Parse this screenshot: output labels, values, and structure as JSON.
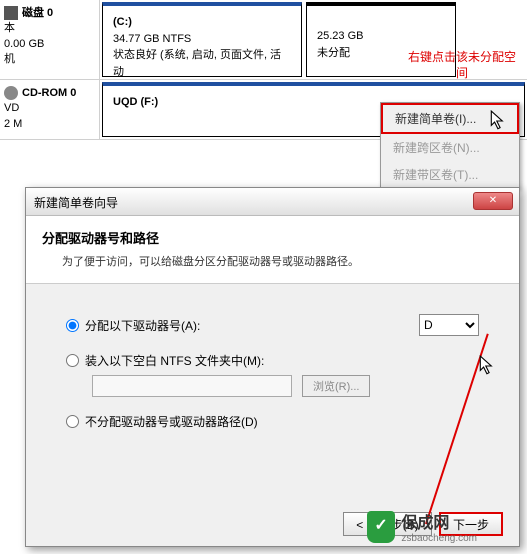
{
  "disk_mgmt": {
    "disk0": {
      "name": "磁盘 0",
      "type": "本",
      "size": "0.00 GB",
      "status": "机"
    },
    "partition_c": {
      "label": "(C:)",
      "size": "34.77 GB NTFS",
      "status": "状态良好 (系统, 启动, 页面文件, 活动"
    },
    "partition_unalloc": {
      "size": "25.23 GB",
      "status": "未分配"
    },
    "cdrom": {
      "name": "CD-ROM 0",
      "type": "VD",
      "size": "2 M"
    },
    "partition_uqd": {
      "label": "UQD  (F:)"
    }
  },
  "annotation": "右键点击该未分配空间",
  "context_menu": {
    "item1": "新建简单卷(I)...",
    "item2": "新建跨区卷(N)...",
    "item3": "新建带区卷(T)..."
  },
  "wizard": {
    "title": "新建简单卷向导",
    "heading": "分配驱动器号和路径",
    "subheading": "为了便于访问，可以给磁盘分区分配驱动器号或驱动器路径。",
    "opt_assign": "分配以下驱动器号(A):",
    "drive_letter": "D",
    "opt_mount": "装入以下空白 NTFS 文件夹中(M):",
    "browse": "浏览(R)...",
    "opt_none": "不分配驱动器号或驱动器路径(D)",
    "btn_back": "< 上一步(B)",
    "btn_next": "下一步"
  },
  "watermark": {
    "name": "保成网",
    "url": "zsbaocheng.com"
  }
}
